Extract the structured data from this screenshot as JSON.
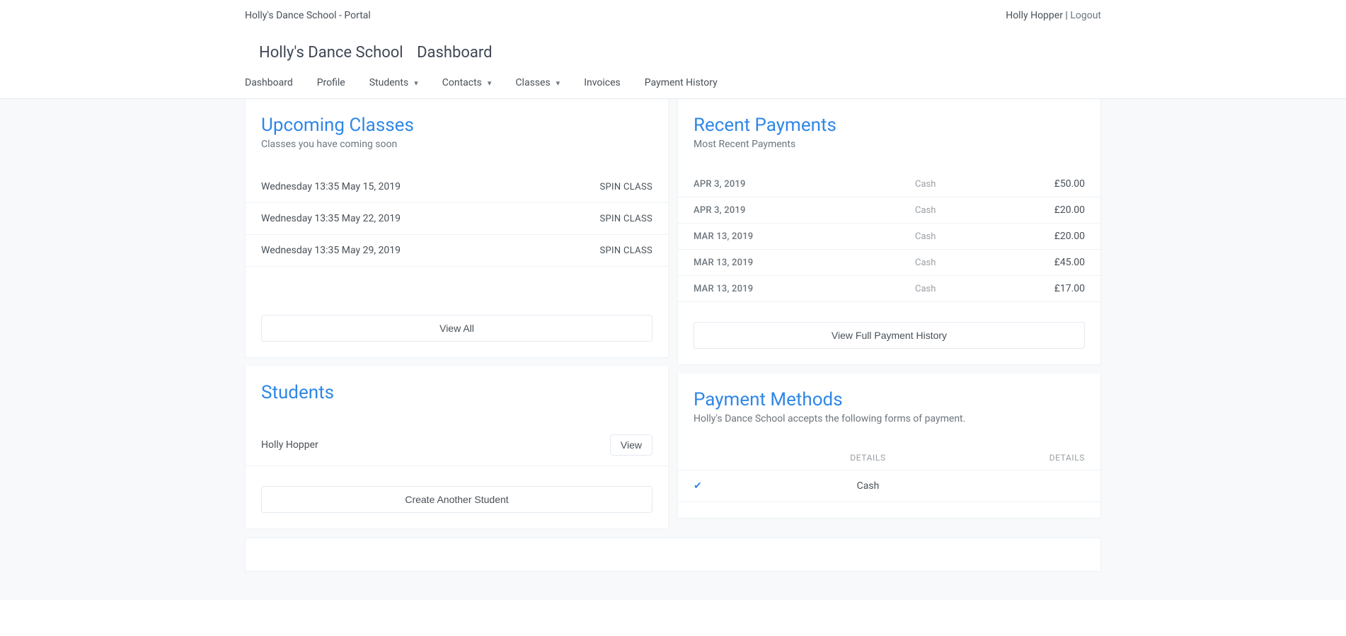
{
  "header": {
    "brand": "Holly's Dance School - Portal",
    "user_name": "Holly Hopper",
    "separator": " | ",
    "logout": "Logout"
  },
  "page_title": {
    "school": "Holly's Dance School",
    "section": "Dashboard"
  },
  "nav": {
    "dashboard": "Dashboard",
    "profile": "Profile",
    "students": "Students",
    "contacts": "Contacts",
    "classes": "Classes",
    "invoices": "Invoices",
    "payment_history": "Payment History"
  },
  "upcoming": {
    "title": "Upcoming Classes",
    "subtitle": "Classes you have coming soon",
    "items": [
      {
        "when": "Wednesday 13:35 May 15, 2019",
        "name": "SPIN CLASS"
      },
      {
        "when": "Wednesday 13:35 May 22, 2019",
        "name": "SPIN CLASS"
      },
      {
        "when": "Wednesday 13:35 May 29, 2019",
        "name": "SPIN CLASS"
      }
    ],
    "view_all": "View All"
  },
  "payments": {
    "title": "Recent Payments",
    "subtitle": "Most Recent Payments",
    "items": [
      {
        "date": "APR 3, 2019",
        "method": "Cash",
        "amount": "£50.00"
      },
      {
        "date": "APR 3, 2019",
        "method": "Cash",
        "amount": "£20.00"
      },
      {
        "date": "MAR 13, 2019",
        "method": "Cash",
        "amount": "£20.00"
      },
      {
        "date": "MAR 13, 2019",
        "method": "Cash",
        "amount": "£45.00"
      },
      {
        "date": "MAR 13, 2019",
        "method": "Cash",
        "amount": "£17.00"
      }
    ],
    "view_all": "View Full Payment History"
  },
  "students": {
    "title": "Students",
    "items": [
      {
        "name": "Holly Hopper",
        "view": "View"
      }
    ],
    "create": "Create Another Student"
  },
  "payment_methods": {
    "title": "Payment Methods",
    "subtitle": "Holly's Dance School accepts the following forms of payment.",
    "col_details_left": "DETAILS",
    "col_details_right": "DETAILS",
    "items": [
      {
        "enabled": true,
        "name": "Cash"
      }
    ]
  }
}
